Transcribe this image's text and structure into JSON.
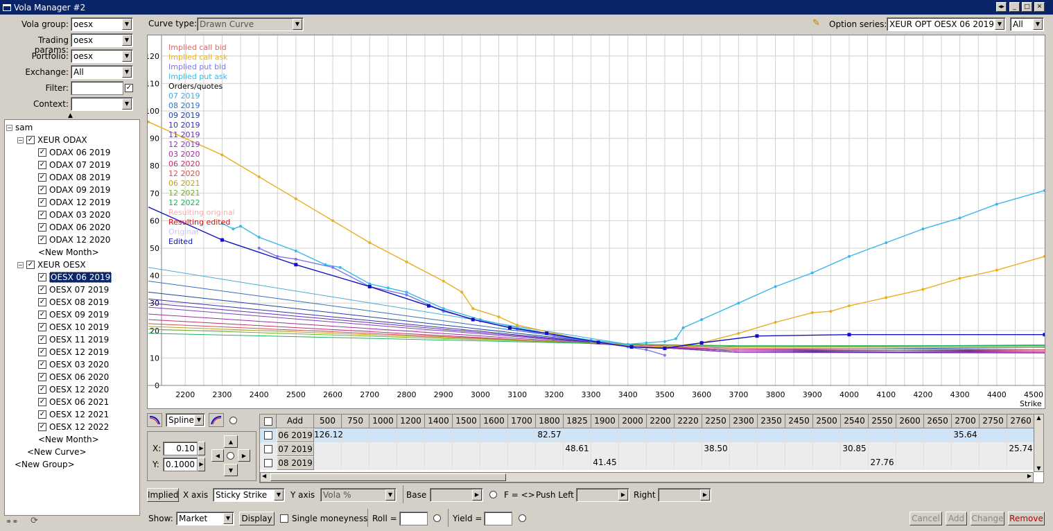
{
  "window": {
    "title": "Vola Manager #2"
  },
  "left_form": {
    "vola_group": {
      "label": "Vola group:",
      "value": "oesx"
    },
    "trading_params": {
      "label": "Trading params:",
      "value": "oesx"
    },
    "portfolio": {
      "label": "Portfolio:",
      "value": "oesx"
    },
    "exchange": {
      "label": "Exchange:",
      "value": "All"
    },
    "filter": {
      "label": "Filter:",
      "value": ""
    },
    "context": {
      "label": "Context:",
      "value": ""
    }
  },
  "tree": {
    "root": "sam",
    "groups": [
      {
        "name": "XEUR ODAX",
        "items": [
          "ODAX 06 2019",
          "ODAX 07 2019",
          "ODAX 08 2019",
          "ODAX 09 2019",
          "ODAX 12 2019",
          "ODAX 03 2020",
          "ODAX 06 2020",
          "ODAX 12 2020"
        ],
        "new_month": "<New Month>"
      },
      {
        "name": "XEUR OESX",
        "items": [
          "OESX 06 2019",
          "OESX 07 2019",
          "OESX 08 2019",
          "OESX 09 2019",
          "OESX 10 2019",
          "OESX 11 2019",
          "OESX 12 2019",
          "OESX 03 2020",
          "OESX 06 2020",
          "OESX 12 2020",
          "OESX 06 2021",
          "OESX 12 2021",
          "OESX 12 2022"
        ],
        "new_month": "<New Month>"
      }
    ],
    "new_curve": "<New Curve>",
    "new_group": "<New Group>",
    "selected": "OESX 06 2019"
  },
  "top_bar": {
    "curve_type_label": "Curve type:",
    "curve_type_value": "Drawn Curve",
    "option_series_label": "Option series:",
    "option_series_value": "XEUR OPT OESX 06 2019",
    "filter_value": "All"
  },
  "chart_data": {
    "type": "line",
    "xlabel": "Strike",
    "xticks": [
      2200,
      2300,
      2400,
      2500,
      2600,
      2700,
      2800,
      2900,
      3000,
      3100,
      3200,
      3300,
      3400,
      3500,
      3600,
      3700,
      3800,
      3900,
      4000,
      4100,
      4200,
      4300,
      4400,
      4500
    ],
    "yticks": [
      0,
      10,
      20,
      30,
      40,
      50,
      60,
      70,
      80,
      90,
      100,
      110,
      120
    ],
    "xlim": [
      2100,
      4530
    ],
    "ylim": [
      0,
      125
    ],
    "grid": true,
    "legend_position": "top-left",
    "legend": [
      {
        "name": "Implied call bid",
        "color": "#e06666"
      },
      {
        "name": "Implied call ask",
        "color": "#e8b020"
      },
      {
        "name": "Implied put bid",
        "color": "#7b78e8"
      },
      {
        "name": "Implied put ask",
        "color": "#38b8e8"
      },
      {
        "name": "Orders/quotes",
        "color": "#000000"
      },
      {
        "name": "07 2019",
        "color": "#4aa8d8"
      },
      {
        "name": "08 2019",
        "color": "#3070c0"
      },
      {
        "name": "09 2019",
        "color": "#2040a0"
      },
      {
        "name": "10 2019",
        "color": "#3a30b0"
      },
      {
        "name": "11 2019",
        "color": "#6030b0"
      },
      {
        "name": "12 2019",
        "color": "#8040b8"
      },
      {
        "name": "03 2020",
        "color": "#a030a0"
      },
      {
        "name": "06 2020",
        "color": "#c03070"
      },
      {
        "name": "12 2020",
        "color": "#d05050"
      },
      {
        "name": "06 2021",
        "color": "#b8a020"
      },
      {
        "name": "12 2021",
        "color": "#70b020"
      },
      {
        "name": "12 2022",
        "color": "#20b060"
      },
      {
        "name": "Resulting original",
        "color": "#f4b0b0"
      },
      {
        "name": "Resulting edited",
        "color": "#d01010"
      },
      {
        "name": "Original",
        "color": "#c8c8f0"
      },
      {
        "name": "Edited",
        "color": "#1010c0"
      }
    ],
    "series": [
      {
        "name": "Implied call ask",
        "color": "#e8b020",
        "points": [
          [
            2100,
            96
          ],
          [
            2300,
            84
          ],
          [
            2400,
            76
          ],
          [
            2500,
            68
          ],
          [
            2600,
            60
          ],
          [
            2700,
            52
          ],
          [
            2800,
            45
          ],
          [
            2900,
            38
          ],
          [
            2950,
            34
          ],
          [
            2980,
            28
          ],
          [
            3050,
            25
          ],
          [
            3100,
            22
          ],
          [
            3200,
            19
          ],
          [
            3300,
            16
          ],
          [
            3400,
            14.5
          ],
          [
            3500,
            14
          ],
          [
            3600,
            15.5
          ],
          [
            3700,
            19
          ],
          [
            3800,
            23
          ],
          [
            3900,
            26.5
          ],
          [
            3950,
            27
          ],
          [
            4000,
            29
          ],
          [
            4100,
            32
          ],
          [
            4200,
            35
          ],
          [
            4300,
            39
          ],
          [
            4400,
            42
          ],
          [
            4530,
            47
          ]
        ]
      },
      {
        "name": "Implied put ask",
        "color": "#38b8e8",
        "points": [
          [
            2300,
            59
          ],
          [
            2330,
            57
          ],
          [
            2350,
            58
          ],
          [
            2400,
            54
          ],
          [
            2500,
            49
          ],
          [
            2580,
            44
          ],
          [
            2620,
            43
          ],
          [
            2700,
            37
          ],
          [
            2750,
            35.5
          ],
          [
            2800,
            34
          ],
          [
            2900,
            28
          ],
          [
            3000,
            24
          ],
          [
            3100,
            21
          ],
          [
            3200,
            18.5
          ],
          [
            3300,
            16.5
          ],
          [
            3400,
            15
          ],
          [
            3450,
            15.5
          ],
          [
            3500,
            16
          ],
          [
            3530,
            17
          ],
          [
            3550,
            21
          ],
          [
            3600,
            24
          ],
          [
            3700,
            30
          ],
          [
            3800,
            36
          ],
          [
            3900,
            41
          ],
          [
            4000,
            47
          ],
          [
            4100,
            52
          ],
          [
            4200,
            57
          ],
          [
            4300,
            61
          ],
          [
            4400,
            66
          ],
          [
            4530,
            71
          ]
        ]
      },
      {
        "name": "Implied put bid",
        "color": "#7b78e8",
        "points": [
          [
            2400,
            50
          ],
          [
            2450,
            47
          ],
          [
            2500,
            46
          ],
          [
            2600,
            43
          ],
          [
            2700,
            36
          ],
          [
            2800,
            33
          ],
          [
            2900,
            27
          ],
          [
            3000,
            23.5
          ],
          [
            3100,
            20.5
          ],
          [
            3200,
            18
          ],
          [
            3300,
            16
          ],
          [
            3400,
            14
          ],
          [
            3450,
            13
          ],
          [
            3500,
            11
          ]
        ]
      },
      {
        "name": "Edited",
        "color": "#1010c0",
        "points": [
          [
            2100,
            65
          ],
          [
            2300,
            53
          ],
          [
            2500,
            44
          ],
          [
            2700,
            36
          ],
          [
            2860,
            29
          ],
          [
            2980,
            24
          ],
          [
            3080,
            21
          ],
          [
            3180,
            19
          ],
          [
            3320,
            15.7
          ],
          [
            3410,
            14
          ],
          [
            3500,
            13.5
          ],
          [
            3600,
            15.5
          ],
          [
            3750,
            18
          ],
          [
            4000,
            18.5
          ],
          [
            4530,
            18.5
          ]
        ]
      },
      {
        "name": "07 2019",
        "color": "#4aa8d8",
        "points": [
          [
            2100,
            43
          ],
          [
            3400,
            15
          ],
          [
            3700,
            14
          ],
          [
            4530,
            14.8
          ]
        ]
      },
      {
        "name": "08 2019",
        "color": "#3070c0",
        "points": [
          [
            2100,
            38
          ],
          [
            3400,
            14.5
          ],
          [
            3700,
            13
          ],
          [
            4530,
            13.8
          ]
        ]
      },
      {
        "name": "09 2019",
        "color": "#2040a0",
        "points": [
          [
            2100,
            34
          ],
          [
            3400,
            14.5
          ],
          [
            3700,
            12.5
          ],
          [
            4530,
            13
          ]
        ]
      },
      {
        "name": "10 2019",
        "color": "#3a30b0",
        "points": [
          [
            2100,
            31.5
          ],
          [
            3400,
            14.5
          ],
          [
            3700,
            12
          ],
          [
            4530,
            12.5
          ]
        ]
      },
      {
        "name": "11 2019",
        "color": "#6030b0",
        "points": [
          [
            2100,
            30
          ],
          [
            3400,
            14.5
          ],
          [
            3700,
            12
          ],
          [
            4530,
            12
          ]
        ]
      },
      {
        "name": "12 2019",
        "color": "#8040b8",
        "points": [
          [
            2100,
            28.5
          ],
          [
            3400,
            14.5
          ],
          [
            3700,
            12
          ],
          [
            4530,
            11.8
          ]
        ]
      },
      {
        "name": "03 2020",
        "color": "#a030a0",
        "points": [
          [
            2100,
            26
          ],
          [
            3400,
            14.5
          ],
          [
            3700,
            12.5
          ],
          [
            4530,
            12
          ]
        ]
      },
      {
        "name": "06 2020",
        "color": "#c03070",
        "points": [
          [
            2100,
            24
          ],
          [
            3400,
            14.5
          ],
          [
            3700,
            13
          ],
          [
            4530,
            12.5
          ]
        ]
      },
      {
        "name": "12 2020",
        "color": "#d05050",
        "points": [
          [
            2100,
            22.5
          ],
          [
            3400,
            14.8
          ],
          [
            3700,
            13.5
          ],
          [
            4530,
            13
          ]
        ]
      },
      {
        "name": "06 2021",
        "color": "#b8a020",
        "points": [
          [
            2100,
            21.5
          ],
          [
            3400,
            15
          ],
          [
            3700,
            14
          ],
          [
            4530,
            13.8
          ]
        ]
      },
      {
        "name": "12 2021",
        "color": "#70b020",
        "points": [
          [
            2100,
            20.5
          ],
          [
            3400,
            15
          ],
          [
            3700,
            14.2
          ],
          [
            4530,
            14.2
          ]
        ]
      },
      {
        "name": "12 2022",
        "color": "#20b060",
        "points": [
          [
            2100,
            19
          ],
          [
            3400,
            15
          ],
          [
            3700,
            14.5
          ],
          [
            4530,
            14.5
          ]
        ]
      }
    ]
  },
  "editor": {
    "spline_value": "Spline",
    "x_label": "X:",
    "x_value": "0.10",
    "y_label": "Y:",
    "y_value": "0.1000"
  },
  "table": {
    "add_label": "Add",
    "columns": [
      "500",
      "750",
      "1000",
      "1200",
      "1400",
      "1500",
      "1600",
      "1700",
      "1800",
      "1825",
      "1900",
      "2000",
      "2200",
      "2220",
      "2250",
      "2300",
      "2350",
      "2450",
      "2500",
      "2540",
      "2550",
      "2600",
      "2650",
      "2700",
      "2750",
      "2760"
    ],
    "rows": [
      {
        "label": "06 2019",
        "cells": {
          "500": "126.12",
          "1800": "82.57",
          "2700": "35.64"
        }
      },
      {
        "label": "07 2019",
        "cells": {
          "1825": "48.61",
          "2250": "38.50",
          "2540": "30.85",
          "2760": "25.74"
        }
      },
      {
        "label": "08 2019",
        "cells": {
          "1900": "41.45",
          "2550": "27.76"
        }
      }
    ]
  },
  "bottom1": {
    "implied": "Implied",
    "x_axis_label": "X axis",
    "x_axis_value": "Sticky Strike",
    "y_axis_label": "Y axis",
    "y_axis_value": "Vola %",
    "base_label": "Base",
    "f_label": "F = <>",
    "push_left_label": "Push Left",
    "right_label": "Right"
  },
  "bottom2": {
    "show_label": "Show:",
    "show_value": "Market",
    "display": "Display",
    "single_moneyness": "Single moneyness",
    "roll_label": "Roll =",
    "yield_label": "Yield =",
    "cancel": "Cancel",
    "add": "Add",
    "change": "Change",
    "remove": "Remove"
  }
}
